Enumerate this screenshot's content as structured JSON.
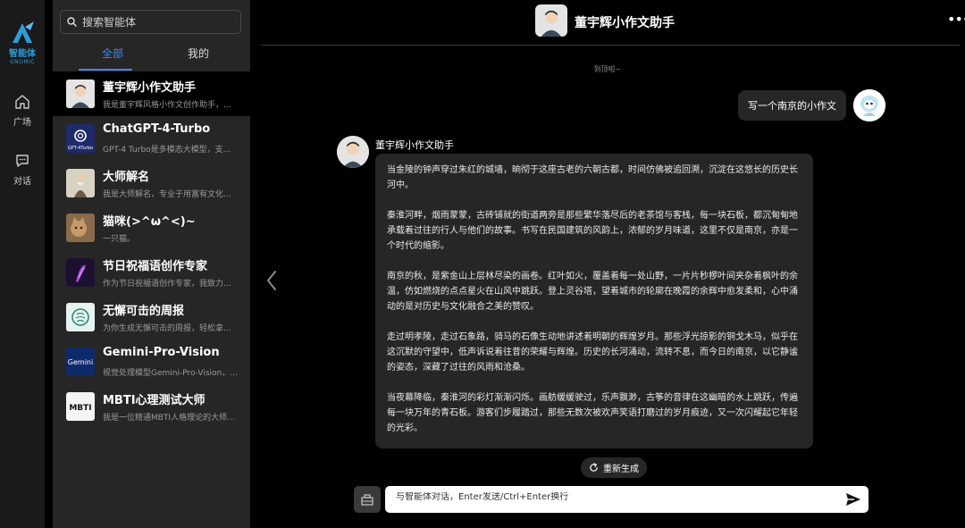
{
  "brand": {
    "name": "智能体",
    "sub": "GNOMIC",
    "accent": "#2d9cdb"
  },
  "rail": {
    "items": [
      {
        "label": "广场",
        "icon": "home-icon"
      },
      {
        "label": "对话",
        "icon": "chat-icon"
      }
    ]
  },
  "sidebar": {
    "search_placeholder": "搜索智能体",
    "tabs": [
      {
        "label": "全部",
        "active": true
      },
      {
        "label": "我的",
        "active": false
      }
    ],
    "agents": [
      {
        "name": "董宇辉小作文助手",
        "desc": "我是董宇辉风格小作文创作助手，...",
        "selected": true
      },
      {
        "name": "ChatGPT-4-Turbo",
        "desc": "GPT-4 Turbo是多模态大模型，支...",
        "badge": "GPT-4Turbo"
      },
      {
        "name": "大师解名",
        "desc": "我是大师解名，专业于用富有文化..."
      },
      {
        "name": "猫咪(>^ω^<)~",
        "desc": "一只猫。"
      },
      {
        "name": "节日祝福语创作专家",
        "desc": "作为节日祝福语创作专家，我致力..."
      },
      {
        "name": "无懈可击的周报",
        "desc": "为你生成无懈可击的周报，轻松拿..."
      },
      {
        "name": "Gemini-Pro-Vision",
        "desc": "视觉处理模型Gemini-Pro-Vision，...",
        "badge": "Gemini"
      },
      {
        "name": "MBTI心理测试大师",
        "desc": "我是一位精通MBTI人格理论的大师...",
        "badge": "MBTI"
      }
    ]
  },
  "chat": {
    "title": "董宇辉小作文助手",
    "more": "•••",
    "top_hint": "到顶啦~",
    "user_message": "写一个南京的小作文",
    "bot_name": "董宇辉小作文助手",
    "bot_paragraphs": [
      "当金陵的钟声穿过朱红的城墙，晌彻于这座古老的六朝古都，时间仿佛被追回溯，沉淀在这悠长的历史长河中。",
      "秦淮河畔，烟雨蒙蒙，古砖铺就的街道两旁是那些繁华落尽后的老茶馆与客栈，每一块石板，都沉甸甸地承载着过往的行人与他们的故事。书写在民国建筑的风韵上，浓郁的岁月味道，这里不仅是南京，亦是一个时代的缩影。",
      "南京的秋，是紫金山上层林尽染的画卷。红叶如火，覆盖着每一处山野，一片片秒椤叶间夹杂着枫叶的余温，仿如燃烧的点点星火在山风中跳跃。登上灵谷塔，望着城市的轮廓在晚霞的余辉中愈发柔和，心中涌动的是对历史与文化融合之美的赞叹。",
      "走过明孝陵，走过石象路，骑马的石像生动地讲述着明朝的辉煌岁月。那些浮光掠影的铜戈木马，似乎在这沉默的守望中，低声诉说着往昔的荣耀与辉煌。历史的长河涌动，流转不息，而今日的南京，以它静谧的姿态，深藏了过往的风雨和沧桑。",
      "当夜幕降临，秦淮河的彩灯渐渐闪烁。画舫缓缓驶过，乐声飘渺，古筝的音律在这幽暗的水上跳跃，传遍每一块万年的青石板。游客们步履踏过，那些无数次被欢声笑语打磨过的岁月痕迹，又一次闪耀起它年轻的光彩。"
    ],
    "regenerate_label": "重新生成",
    "input_placeholder": "与智能体对话，Enter发送/Ctrl+Enter换行"
  }
}
